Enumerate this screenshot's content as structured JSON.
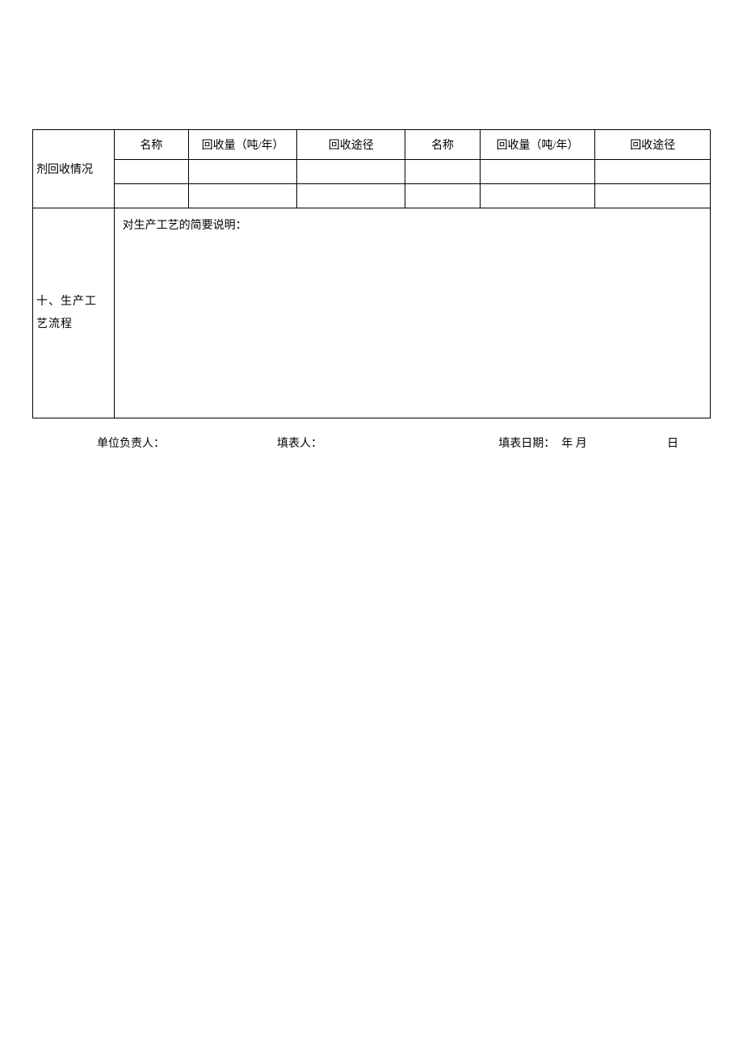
{
  "table": {
    "row1": {
      "col0": "剂回收情况",
      "col1": "名称",
      "col2": "回收量（吨/年）",
      "col3": "回收途径",
      "col4": "名称",
      "col5": "回收量（吨/年）",
      "col6": "回收途径"
    },
    "process": {
      "label": "十、生产工 艺流程",
      "desc": "对生产工艺的简要说明："
    }
  },
  "footer": {
    "responsible": "单位负责人：",
    "filler": "填表人：",
    "date_label": "填表日期：",
    "year_month": "年 月",
    "day": "日"
  }
}
